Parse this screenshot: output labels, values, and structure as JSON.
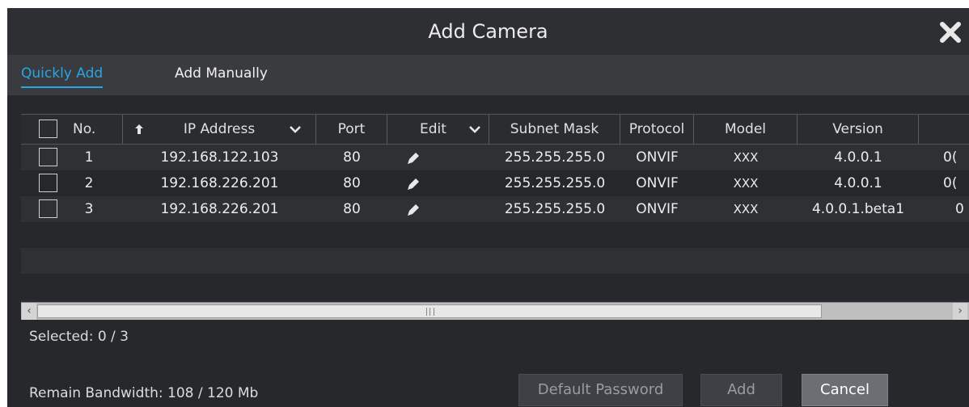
{
  "window": {
    "title": "Add Camera"
  },
  "tabs": [
    {
      "label": "Quickly Add",
      "active": true
    },
    {
      "label": "Add Manually",
      "active": false
    }
  ],
  "table": {
    "columns": [
      "No.",
      "IP Address",
      "Port",
      "Edit",
      "Subnet Mask",
      "Protocol",
      "Model",
      "Version"
    ],
    "rows": [
      {
        "no": "1",
        "ip": "192.168.122.103",
        "port": "80",
        "subnet": "255.255.255.0",
        "protocol": "ONVIF",
        "model": "XXX",
        "version": "4.0.0.1",
        "extra": "0("
      },
      {
        "no": "2",
        "ip": "192.168.226.201",
        "port": "80",
        "subnet": "255.255.255.0",
        "protocol": "ONVIF",
        "model": "XXX",
        "version": "4.0.0.1",
        "extra": "0("
      },
      {
        "no": "3",
        "ip": "192.168.226.201",
        "port": "80",
        "subnet": "255.255.255.0",
        "protocol": "ONVIF",
        "model": "XXX",
        "version": "4.0.0.1.beta1",
        "extra": "0"
      }
    ]
  },
  "status": {
    "selected": "Selected: 0 / 3",
    "bandwidth": "Remain Bandwidth: 108 / 120 Mb"
  },
  "buttons": {
    "default_password": "Default Password",
    "add": "Add",
    "cancel": "Cancel"
  },
  "icons": {
    "close": "close-x-icon",
    "sort": "sort-up-arrow-icon",
    "dropdown": "chevron-down-icon",
    "edit": "pencil-icon"
  },
  "colors": {
    "accent": "#2aa4e6",
    "dialog_bg": "#26282b",
    "tab_bar_bg": "#393b3f"
  }
}
